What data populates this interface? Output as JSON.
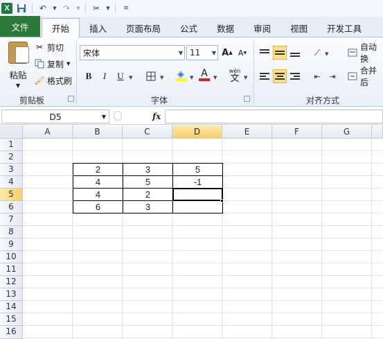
{
  "quick_access": {
    "icons": [
      "excel-logo",
      "save-icon",
      "undo-icon",
      "redo-icon",
      "tools-icon",
      "customize-icon"
    ]
  },
  "tabs": [
    {
      "label": "文件",
      "key": "file"
    },
    {
      "label": "开始",
      "key": "home"
    },
    {
      "label": "插入",
      "key": "insert"
    },
    {
      "label": "页面布局",
      "key": "layout"
    },
    {
      "label": "公式",
      "key": "formulas"
    },
    {
      "label": "数据",
      "key": "data"
    },
    {
      "label": "审阅",
      "key": "review"
    },
    {
      "label": "视图",
      "key": "view"
    },
    {
      "label": "开发工具",
      "key": "developer"
    }
  ],
  "clipboard": {
    "paste_label": "粘贴",
    "cut_label": "剪切",
    "copy_label": "复制",
    "format_painter_label": "格式刷",
    "group_label": "剪贴板"
  },
  "font": {
    "name": "宋体",
    "size": "11",
    "bold": "B",
    "italic": "I",
    "underline": "U",
    "wen": "wén",
    "wen_char": "文",
    "grow": "A",
    "shrink": "A",
    "color_letter": "A",
    "group_label": "字体"
  },
  "alignment": {
    "wrap_label": "自动换",
    "merge_label": "合并后",
    "group_label": "对齐方式"
  },
  "formula_bar": {
    "name_box": "D5",
    "fx": "fx",
    "formula": ""
  },
  "columns": [
    "A",
    "B",
    "C",
    "D",
    "E",
    "F",
    "G"
  ],
  "rows": [
    "1",
    "2",
    "3",
    "4",
    "5",
    "6",
    "7",
    "8",
    "9",
    "10",
    "11",
    "12",
    "13",
    "14",
    "15",
    "16"
  ],
  "selected_column": "D",
  "selected_row": "5",
  "cells": {
    "B3": "2",
    "C3": "3",
    "D3": "5",
    "B4": "4",
    "C4": "5",
    "D4": "-1",
    "B5": "4",
    "C5": "2",
    "D5": "",
    "B6": "6",
    "C6": "3",
    "D6": ""
  },
  "colors": {
    "file_tab": "#2c7a3a",
    "selection_header": "#f8cf6a",
    "font_color_bar": "#e02020",
    "fill_color_bar": "#ffff00"
  }
}
